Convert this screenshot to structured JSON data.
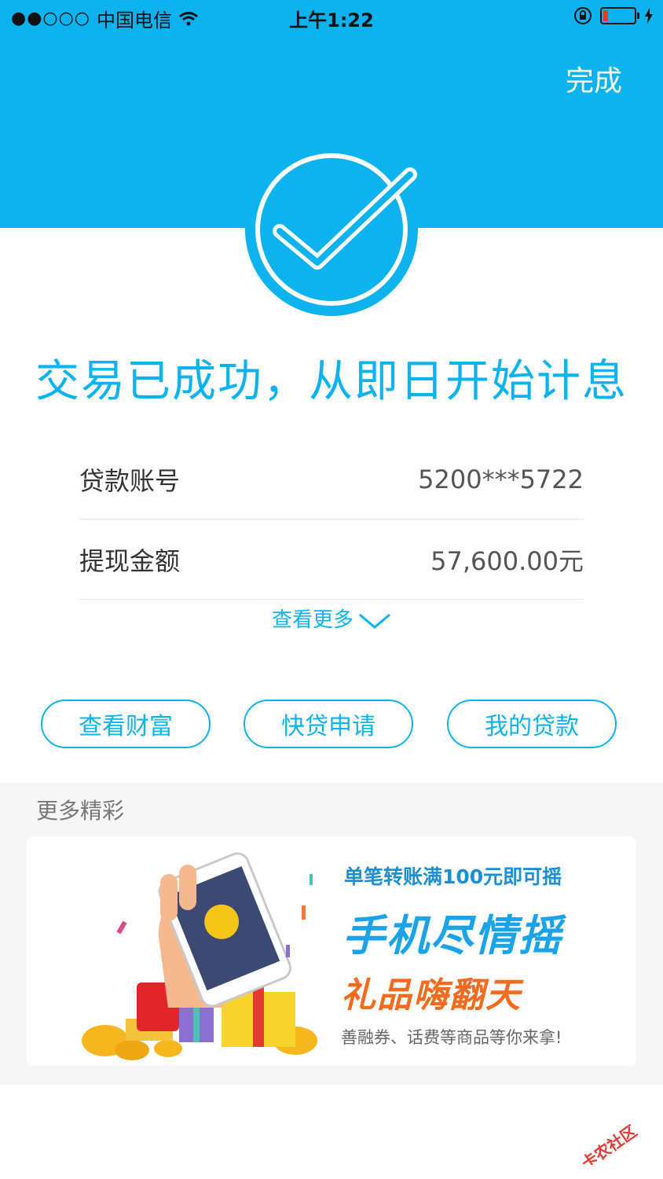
{
  "status_bar": {
    "signal": "●●○○○",
    "carrier": "中国电信",
    "time": "上午1:22"
  },
  "header": {
    "done_label": "完成",
    "accent_color": "#0cb3ee"
  },
  "result": {
    "title": "交易已成功，从即日开始计息"
  },
  "details": {
    "rows": [
      {
        "label": "贷款账号",
        "value": "5200***5722"
      },
      {
        "label": "提现金额",
        "value": "57,600.00元"
      }
    ],
    "more_label": "查看更多"
  },
  "actions": {
    "view_wealth": "查看财富",
    "quick_loan": "快贷申请",
    "my_loans": "我的贷款"
  },
  "more_section": {
    "title": "更多精彩",
    "banner": {
      "line1": "单笔转账满100元即可摇",
      "line2": "手机尽情摇",
      "line3": "礼品嗨翻天",
      "line4": "善融券、话费等商品等你来拿!"
    }
  },
  "watermark": {
    "text": "卡农社区"
  },
  "icons": [
    "wifi-icon",
    "lock-rotation-icon",
    "battery-icon",
    "charging-icon",
    "check-circle-icon",
    "chevron-down-icon"
  ]
}
